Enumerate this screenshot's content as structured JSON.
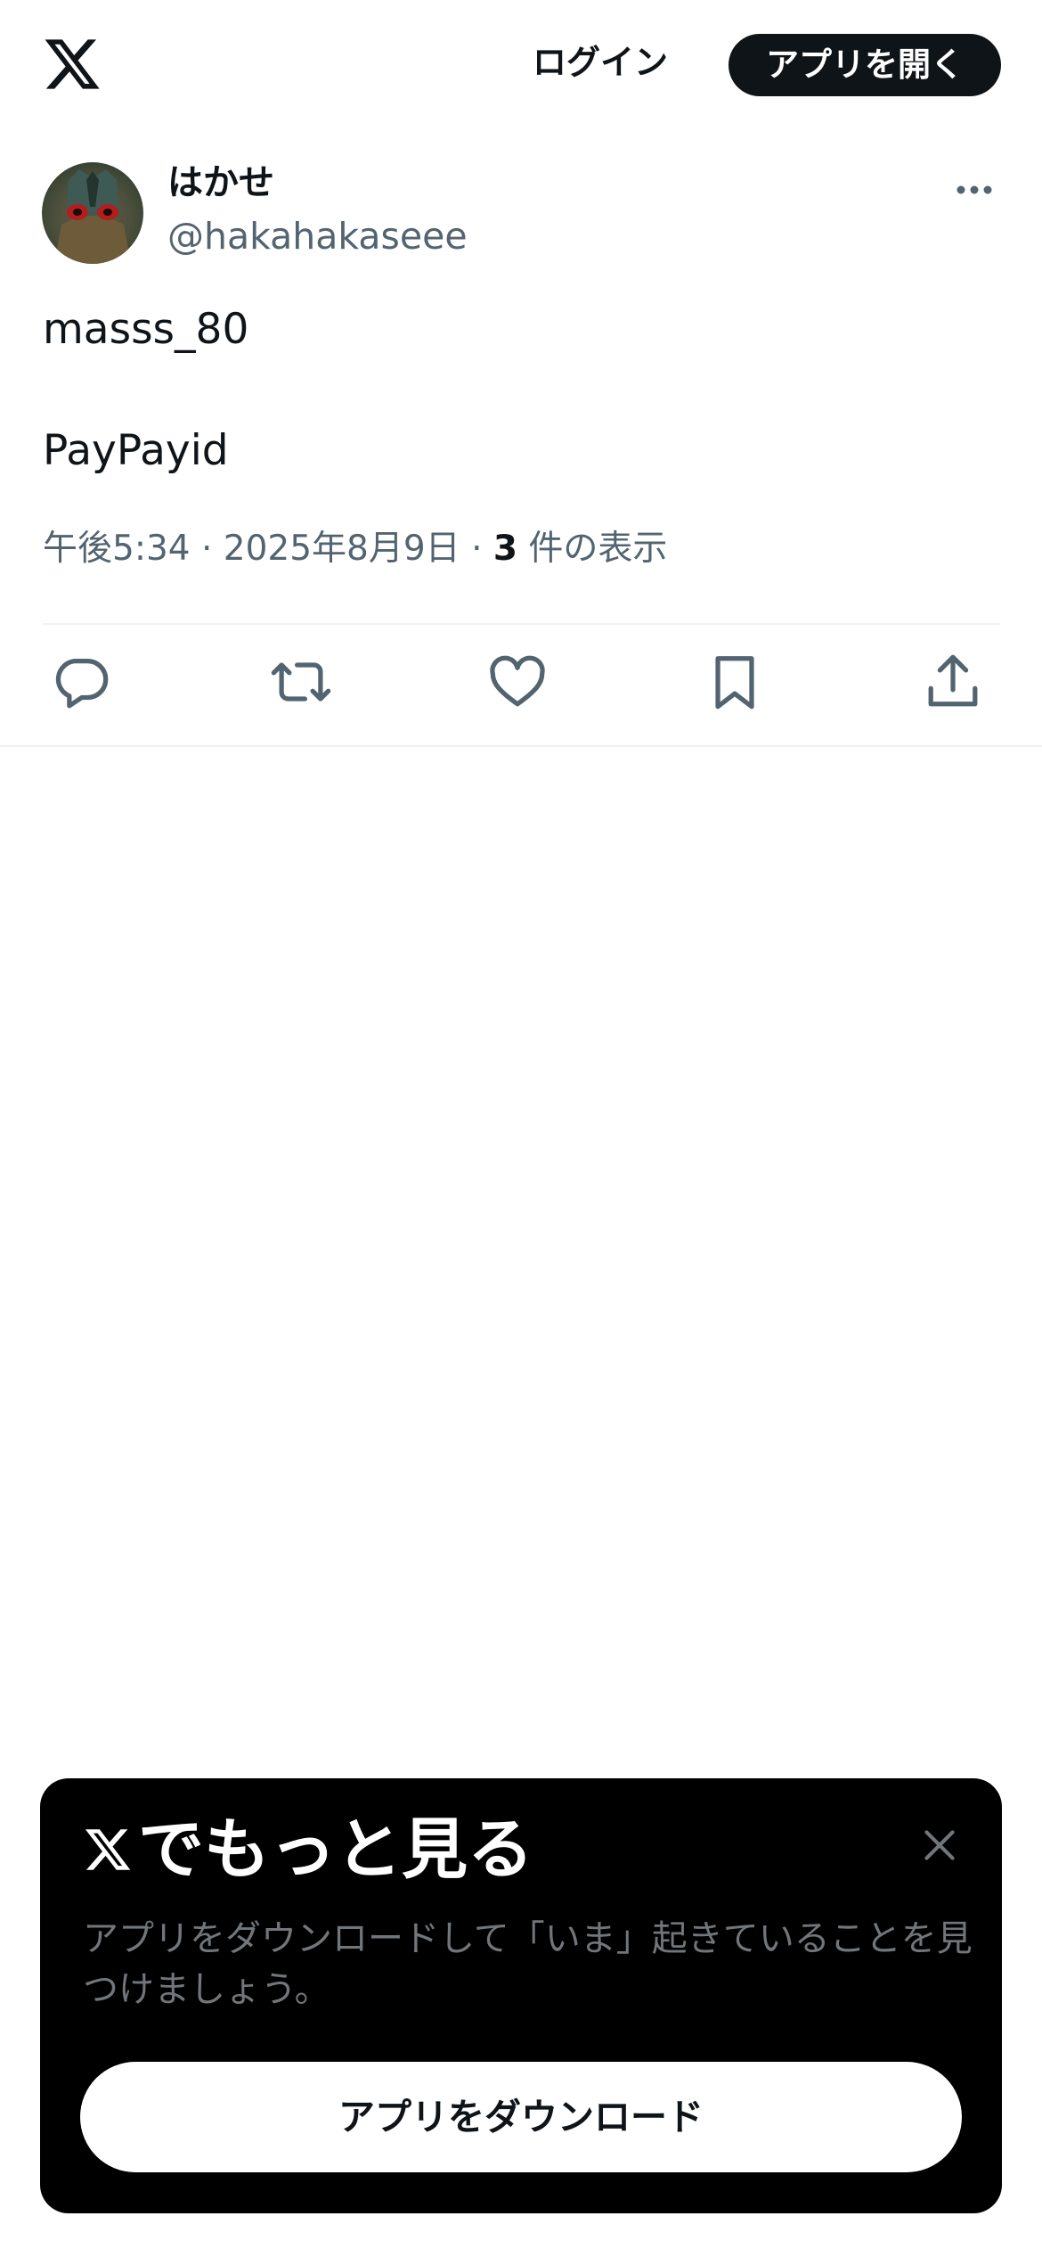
{
  "header": {
    "logo_icon": "x-logo-icon",
    "login_label": "ログイン",
    "open_app_label": "アプリを開く"
  },
  "tweet": {
    "author": {
      "display_name": "はかせ",
      "handle": "@hakahakaseee",
      "avatar_icon": "avatar-image"
    },
    "more_icon": "more-dots-icon",
    "text_lines": [
      "masss_80",
      "",
      "PayPayid"
    ],
    "meta": {
      "time": "午後5:34",
      "separator": " · ",
      "date": "2025年8月9日",
      "views_count": "3",
      "views_label": " 件の表示"
    },
    "actions": [
      {
        "name": "reply",
        "icon": "reply-icon"
      },
      {
        "name": "retweet",
        "icon": "retweet-icon"
      },
      {
        "name": "like",
        "icon": "heart-icon"
      },
      {
        "name": "bookmark",
        "icon": "bookmark-icon"
      },
      {
        "name": "share",
        "icon": "share-icon"
      }
    ]
  },
  "promo": {
    "title": "でもっと見る",
    "description": "アプリをダウンロードして「いま」起きていることを見つけましょう。",
    "download_label": "アプリをダウンロード",
    "close_icon": "close-icon"
  },
  "colors": {
    "text_primary": "#0f1419",
    "text_secondary": "#536471",
    "promo_bg": "#000000",
    "promo_desc": "#71767b",
    "divider": "#eff3f4"
  }
}
